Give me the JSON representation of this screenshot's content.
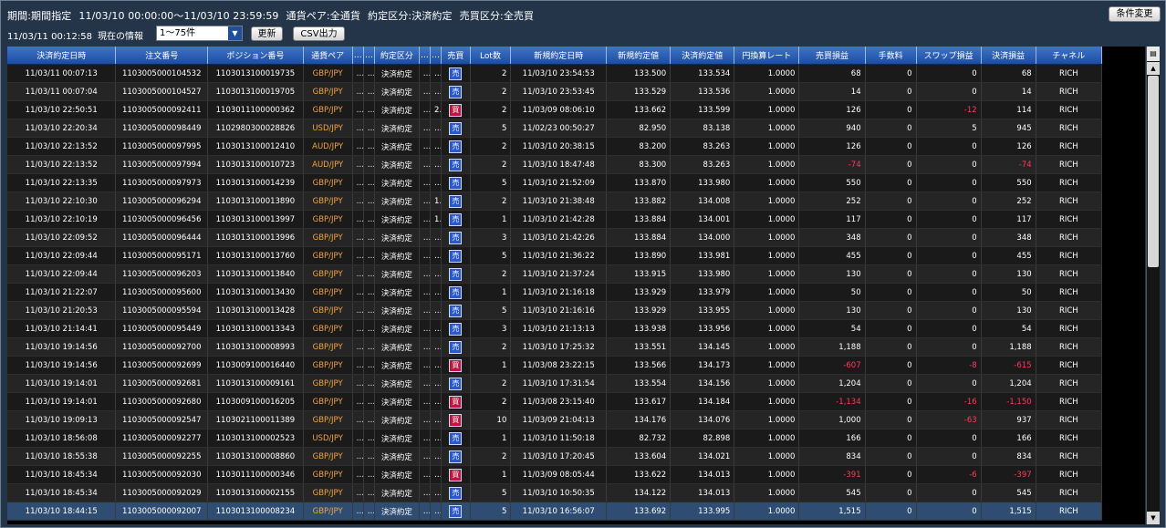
{
  "header": {
    "period_label": "期間:期間指定",
    "period_value": "11/03/10 00:00:00～11/03/10 23:59:59",
    "pair_filter": "通貨ペア:全通貨",
    "exec_filter": "約定区分:決済約定",
    "side_filter": "売買区分:全売買",
    "change_button": "条件変更",
    "timestamp": "11/03/11 00:12:58",
    "current_info": "現在の情報",
    "range_select": "1～75件",
    "refresh_button": "更新",
    "csv_button": "CSV出力"
  },
  "columns": [
    "決済約定日時",
    "注文番号",
    "ポジション番号",
    "通貨ペア",
    "…",
    "…",
    "約定区分",
    "…",
    "…",
    "売買",
    "Lot数",
    "新規約定日時",
    "新規約定値",
    "決済約定値",
    "円換算レート",
    "売買損益",
    "手数料",
    "スワップ損益",
    "決済損益",
    "チャネル"
  ],
  "rows": [
    [
      "11/03/11 00:07:13",
      "1103005000104532",
      "1103013100019735",
      "GBP/JPY",
      "…",
      "…",
      "決済約定",
      "…",
      "…",
      "売",
      "2",
      "11/03/10 23:54:53",
      "133.500",
      "133.534",
      "1.0000",
      "68",
      "0",
      "0",
      "68",
      "RICH"
    ],
    [
      "11/03/11 00:07:04",
      "1103005000104527",
      "1103013100019705",
      "GBP/JPY",
      "…",
      "…",
      "決済約定",
      "…",
      "…",
      "売",
      "2",
      "11/03/10 23:53:45",
      "133.529",
      "133.536",
      "1.0000",
      "14",
      "0",
      "0",
      "14",
      "RICH"
    ],
    [
      "11/03/10 22:50:51",
      "1103005000092411",
      "1103011100000362",
      "GBP/JPY",
      "…",
      "…",
      "決済約定",
      "…",
      "2…",
      "買",
      "2",
      "11/03/09 08:06:10",
      "133.662",
      "133.599",
      "1.0000",
      "126",
      "0",
      "-12",
      "114",
      "RICH"
    ],
    [
      "11/03/10 22:20:34",
      "1103005000098449",
      "1102980300028826",
      "USD/JPY",
      "…",
      "…",
      "決済約定",
      "…",
      "…",
      "売",
      "5",
      "11/02/23 00:50:27",
      "82.950",
      "83.138",
      "1.0000",
      "940",
      "0",
      "5",
      "945",
      "RICH"
    ],
    [
      "11/03/10 22:13:52",
      "1103005000097995",
      "1103013100012410",
      "AUD/JPY",
      "…",
      "…",
      "決済約定",
      "…",
      "…",
      "売",
      "2",
      "11/03/10 20:38:15",
      "83.200",
      "83.263",
      "1.0000",
      "126",
      "0",
      "0",
      "126",
      "RICH"
    ],
    [
      "11/03/10 22:13:52",
      "1103005000097994",
      "1103013100010723",
      "AUD/JPY",
      "…",
      "…",
      "決済約定",
      "…",
      "…",
      "売",
      "2",
      "11/03/10 18:47:48",
      "83.300",
      "83.263",
      "1.0000",
      "-74",
      "0",
      "0",
      "-74",
      "RICH"
    ],
    [
      "11/03/10 22:13:35",
      "1103005000097973",
      "1103013100014239",
      "GBP/JPY",
      "…",
      "…",
      "決済約定",
      "…",
      "…",
      "売",
      "5",
      "11/03/10 21:52:09",
      "133.870",
      "133.980",
      "1.0000",
      "550",
      "0",
      "0",
      "550",
      "RICH"
    ],
    [
      "11/03/10 22:10:30",
      "1103005000096294",
      "1103013100013890",
      "GBP/JPY",
      "…",
      "…",
      "決済約定",
      "…",
      "1…",
      "売",
      "2",
      "11/03/10 21:38:48",
      "133.882",
      "134.008",
      "1.0000",
      "252",
      "0",
      "0",
      "252",
      "RICH"
    ],
    [
      "11/03/10 22:10:19",
      "1103005000096456",
      "1103013100013997",
      "GBP/JPY",
      "…",
      "…",
      "決済約定",
      "…",
      "1…",
      "売",
      "1",
      "11/03/10 21:42:28",
      "133.884",
      "134.001",
      "1.0000",
      "117",
      "0",
      "0",
      "117",
      "RICH"
    ],
    [
      "11/03/10 22:09:52",
      "1103005000096444",
      "1103013100013996",
      "GBP/JPY",
      "…",
      "…",
      "決済約定",
      "…",
      "…",
      "売",
      "3",
      "11/03/10 21:42:26",
      "133.884",
      "134.000",
      "1.0000",
      "348",
      "0",
      "0",
      "348",
      "RICH"
    ],
    [
      "11/03/10 22:09:44",
      "1103005000095171",
      "1103013100013760",
      "GBP/JPY",
      "…",
      "…",
      "決済約定",
      "…",
      "…",
      "売",
      "5",
      "11/03/10 21:36:22",
      "133.890",
      "133.981",
      "1.0000",
      "455",
      "0",
      "0",
      "455",
      "RICH"
    ],
    [
      "11/03/10 22:09:44",
      "1103005000096203",
      "1103013100013840",
      "GBP/JPY",
      "…",
      "…",
      "決済約定",
      "…",
      "…",
      "売",
      "2",
      "11/03/10 21:37:24",
      "133.915",
      "133.980",
      "1.0000",
      "130",
      "0",
      "0",
      "130",
      "RICH"
    ],
    [
      "11/03/10 21:22:07",
      "1103005000095600",
      "1103013100013430",
      "GBP/JPY",
      "…",
      "…",
      "決済約定",
      "…",
      "…",
      "売",
      "1",
      "11/03/10 21:16:18",
      "133.929",
      "133.979",
      "1.0000",
      "50",
      "0",
      "0",
      "50",
      "RICH"
    ],
    [
      "11/03/10 21:20:53",
      "1103005000095594",
      "1103013100013428",
      "GBP/JPY",
      "…",
      "…",
      "決済約定",
      "…",
      "…",
      "売",
      "5",
      "11/03/10 21:16:16",
      "133.929",
      "133.955",
      "1.0000",
      "130",
      "0",
      "0",
      "130",
      "RICH"
    ],
    [
      "11/03/10 21:14:41",
      "1103005000095449",
      "1103013100013343",
      "GBP/JPY",
      "…",
      "…",
      "決済約定",
      "…",
      "…",
      "売",
      "3",
      "11/03/10 21:13:13",
      "133.938",
      "133.956",
      "1.0000",
      "54",
      "0",
      "0",
      "54",
      "RICH"
    ],
    [
      "11/03/10 19:14:56",
      "1103005000092700",
      "1103013100008993",
      "GBP/JPY",
      "…",
      "…",
      "決済約定",
      "…",
      "…",
      "売",
      "2",
      "11/03/10 17:25:32",
      "133.551",
      "134.145",
      "1.0000",
      "1,188",
      "0",
      "0",
      "1,188",
      "RICH"
    ],
    [
      "11/03/10 19:14:56",
      "1103005000092699",
      "1103009100016440",
      "GBP/JPY",
      "…",
      "…",
      "決済約定",
      "…",
      "…",
      "買",
      "1",
      "11/03/08 23:22:15",
      "133.566",
      "134.173",
      "1.0000",
      "-607",
      "0",
      "-8",
      "-615",
      "RICH"
    ],
    [
      "11/03/10 19:14:01",
      "1103005000092681",
      "1103013100009161",
      "GBP/JPY",
      "…",
      "…",
      "決済約定",
      "…",
      "…",
      "売",
      "2",
      "11/03/10 17:31:54",
      "133.554",
      "134.156",
      "1.0000",
      "1,204",
      "0",
      "0",
      "1,204",
      "RICH"
    ],
    [
      "11/03/10 19:14:01",
      "1103005000092680",
      "1103009100016205",
      "GBP/JPY",
      "…",
      "…",
      "決済約定",
      "…",
      "…",
      "買",
      "2",
      "11/03/08 23:15:40",
      "133.617",
      "134.184",
      "1.0000",
      "-1,134",
      "0",
      "-16",
      "-1,150",
      "RICH"
    ],
    [
      "11/03/10 19:09:13",
      "1103005000092547",
      "1103021100011389",
      "GBP/JPY",
      "…",
      "…",
      "決済約定",
      "…",
      "…",
      "買",
      "10",
      "11/03/09 21:04:13",
      "134.176",
      "134.076",
      "1.0000",
      "1,000",
      "0",
      "-63",
      "937",
      "RICH"
    ],
    [
      "11/03/10 18:56:08",
      "1103005000092277",
      "1103013100002523",
      "USD/JPY",
      "…",
      "…",
      "決済約定",
      "…",
      "…",
      "売",
      "1",
      "11/03/10 11:50:18",
      "82.732",
      "82.898",
      "1.0000",
      "166",
      "0",
      "0",
      "166",
      "RICH"
    ],
    [
      "11/03/10 18:55:38",
      "1103005000092255",
      "1103013100008860",
      "GBP/JPY",
      "…",
      "…",
      "決済約定",
      "…",
      "…",
      "売",
      "2",
      "11/03/10 17:20:45",
      "133.604",
      "134.021",
      "1.0000",
      "834",
      "0",
      "0",
      "834",
      "RICH"
    ],
    [
      "11/03/10 18:45:34",
      "1103005000092030",
      "1103011100000346",
      "GBP/JPY",
      "…",
      "…",
      "決済約定",
      "…",
      "…",
      "買",
      "1",
      "11/03/09 08:05:44",
      "133.622",
      "134.013",
      "1.0000",
      "-391",
      "0",
      "-6",
      "-397",
      "RICH"
    ],
    [
      "11/03/10 18:45:34",
      "1103005000092029",
      "1103013100002155",
      "GBP/JPY",
      "…",
      "…",
      "決済約定",
      "…",
      "…",
      "売",
      "5",
      "11/03/10 10:50:35",
      "134.122",
      "134.013",
      "1.0000",
      "545",
      "0",
      "0",
      "545",
      "RICH"
    ],
    [
      "11/03/10 18:44:15",
      "1103005000092007",
      "1103013100008234",
      "GBP/JPY",
      "…",
      "…",
      "決済約定",
      "…",
      "…",
      "売",
      "5",
      "11/03/10 16:56:07",
      "133.692",
      "133.995",
      "1.0000",
      "1,515",
      "0",
      "0",
      "1,515",
      "RICH"
    ]
  ],
  "selected_row": 24,
  "colors": {
    "pair": "#f2a53c",
    "negative": "#ff3b5c",
    "sell_badge": "#2a57d4",
    "buy_badge": "#c2143c",
    "header": "#1c4da3"
  },
  "icons": {
    "scroll_up": "triangle-up-icon",
    "scroll_down": "triangle-down-icon",
    "column_menu": "column-menu-icon"
  }
}
